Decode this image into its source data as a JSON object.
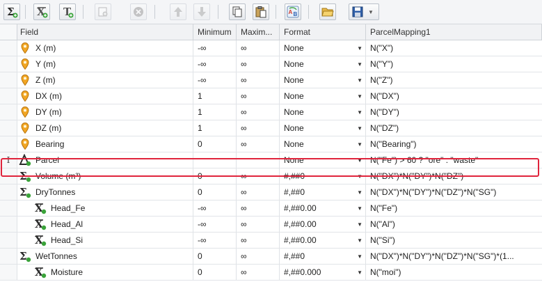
{
  "toolbar": {
    "buttons": [
      {
        "name": "add-expression-button",
        "icon": "sigma-icon",
        "enabled": true
      },
      {
        "name": "add-variable-button",
        "icon": "x-variable-icon",
        "enabled": true
      },
      {
        "name": "add-text-button",
        "icon": "text-t-icon",
        "enabled": true
      },
      {
        "name": "add-child-button",
        "icon": "add-child-icon",
        "enabled": false
      },
      {
        "name": "delete-button",
        "icon": "delete-circle-icon",
        "enabled": false
      },
      {
        "name": "move-up-button",
        "icon": "arrow-up-icon",
        "enabled": false
      },
      {
        "name": "move-down-button",
        "icon": "arrow-down-icon",
        "enabled": false
      },
      {
        "name": "copy-button",
        "icon": "copy-icon",
        "enabled": true
      },
      {
        "name": "paste-button",
        "icon": "paste-icon",
        "enabled": true
      },
      {
        "name": "rename-button",
        "icon": "ab-rename-icon",
        "enabled": true
      },
      {
        "name": "open-button",
        "icon": "folder-open-icon",
        "enabled": true
      },
      {
        "name": "save-button",
        "icon": "save-floppy-icon",
        "enabled": true
      }
    ]
  },
  "columns": {
    "field": "Field",
    "minimum": "Minimum",
    "maximum": "Maxim...",
    "format": "Format",
    "mapping": "ParcelMapping1"
  },
  "rows": [
    {
      "indent": 0,
      "icon": "location-pin-icon",
      "field": "X (m)",
      "min": "-∞",
      "max": "∞",
      "format": "None",
      "mapping": "N(\"X\")"
    },
    {
      "indent": 0,
      "icon": "location-pin-icon",
      "field": "Y (m)",
      "min": "-∞",
      "max": "∞",
      "format": "None",
      "mapping": "N(\"Y\")"
    },
    {
      "indent": 0,
      "icon": "location-pin-icon",
      "field": "Z (m)",
      "min": "-∞",
      "max": "∞",
      "format": "None",
      "mapping": "N(\"Z\")"
    },
    {
      "indent": 0,
      "icon": "location-pin-icon",
      "field": "DX (m)",
      "min": "1",
      "max": "∞",
      "format": "None",
      "mapping": "N(\"DX\")"
    },
    {
      "indent": 0,
      "icon": "location-pin-icon",
      "field": "DY (m)",
      "min": "1",
      "max": "∞",
      "format": "None",
      "mapping": "N(\"DY\")"
    },
    {
      "indent": 0,
      "icon": "location-pin-icon",
      "field": "DZ (m)",
      "min": "1",
      "max": "∞",
      "format": "None",
      "mapping": "N(\"DZ\")"
    },
    {
      "indent": 0,
      "icon": "location-pin-icon",
      "field": "Bearing",
      "min": "0",
      "max": "∞",
      "format": "None",
      "mapping": "N(\"Bearing\")"
    },
    {
      "indent": 0,
      "icon": "category-icon",
      "field": "Parcel",
      "min": "",
      "max": "",
      "format": "None",
      "mapping": "N(\"Fe\") > 60 ? \"ore\" : \"waste\"",
      "selected": true,
      "indicator": "I"
    },
    {
      "indent": 0,
      "icon": "sigma-icon",
      "field": "Volume (m³)",
      "min": "0",
      "max": "∞",
      "format": "#,##0",
      "mapping": "N(\"DX\")*N(\"DY\")*N(\"DZ\")"
    },
    {
      "indent": 0,
      "icon": "sigma-icon",
      "field": "DryTonnes",
      "min": "0",
      "max": "∞",
      "format": "#,##0",
      "mapping": "N(\"DX\")*N(\"DY\")*N(\"DZ\")*N(\"SG\")"
    },
    {
      "indent": 1,
      "icon": "x-variable-icon",
      "field": "Head_Fe",
      "min": "-∞",
      "max": "∞",
      "format": "#,##0.00",
      "mapping": "N(\"Fe\")"
    },
    {
      "indent": 1,
      "icon": "x-variable-icon",
      "field": "Head_Al",
      "min": "-∞",
      "max": "∞",
      "format": "#,##0.00",
      "mapping": "N(\"Al\")"
    },
    {
      "indent": 1,
      "icon": "x-variable-icon",
      "field": "Head_Si",
      "min": "-∞",
      "max": "∞",
      "format": "#,##0.00",
      "mapping": "N(\"Si\")"
    },
    {
      "indent": 0,
      "icon": "sigma-icon",
      "field": "WetTonnes",
      "min": "0",
      "max": "∞",
      "format": "#,##0",
      "mapping": "N(\"DX\")*N(\"DY\")*N(\"DZ\")*N(\"SG\")*(1..."
    },
    {
      "indent": 1,
      "icon": "x-variable-icon",
      "field": "Moisture",
      "min": "0",
      "max": "∞",
      "format": "#,##0.000",
      "mapping": "N(\"moi\")"
    }
  ],
  "colors": {
    "selection_border": "#e0243c",
    "pin": "#f2a623",
    "sigma": "#2b2b2b",
    "plus_badge": "#3aa33a"
  }
}
